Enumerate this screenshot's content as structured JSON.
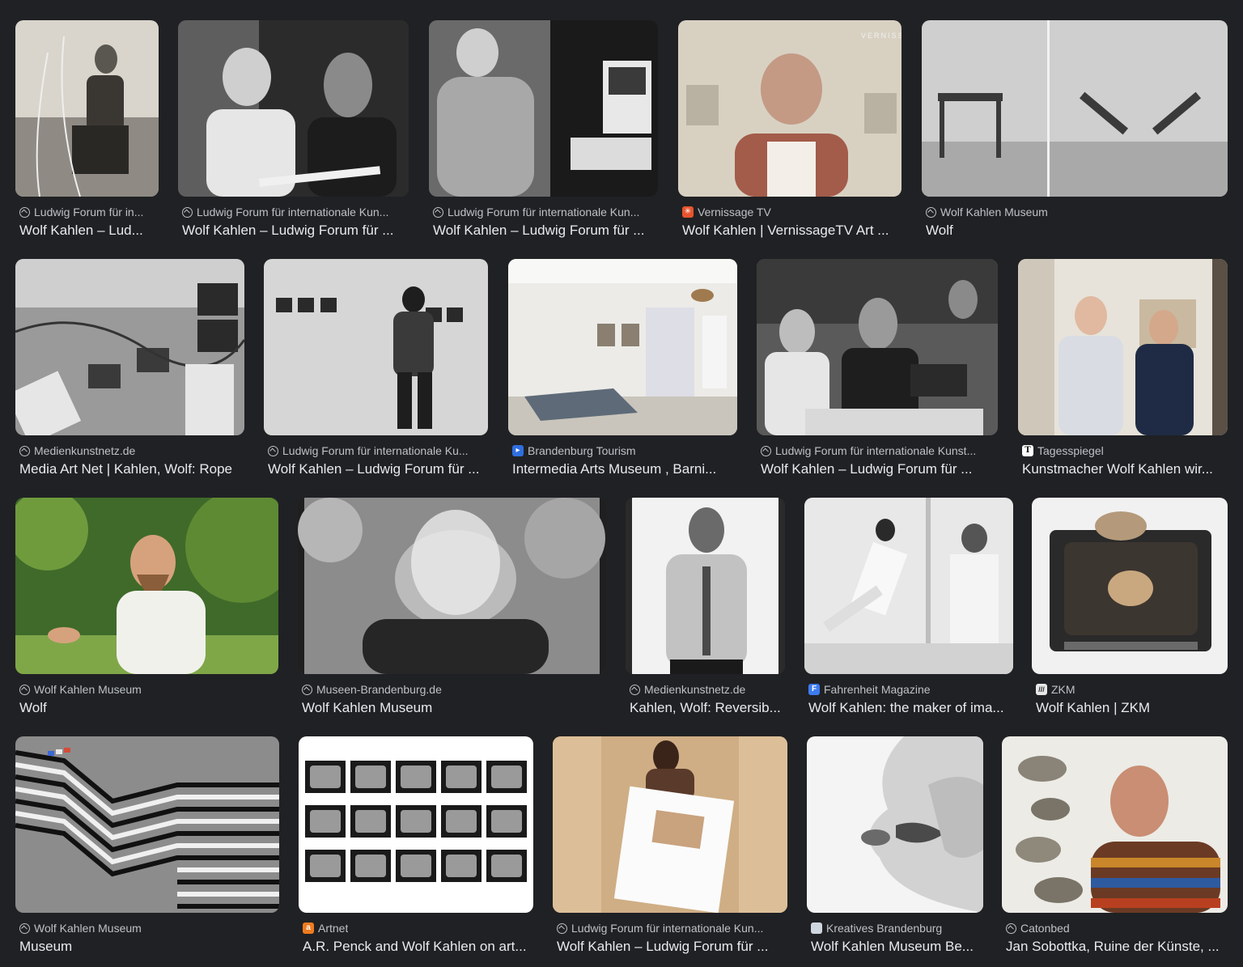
{
  "results": [
    {
      "source": "Ludwig Forum für in...",
      "title": "Wolf Kahlen – Lud...",
      "favicon": "globe-icon"
    },
    {
      "source": "Ludwig Forum für internationale Kun...",
      "title": "Wolf Kahlen – Ludwig Forum für ...",
      "favicon": "globe-icon"
    },
    {
      "source": "Ludwig Forum für internationale Kun...",
      "title": "Wolf Kahlen – Ludwig Forum für ...",
      "favicon": "globe-icon"
    },
    {
      "source": "Vernissage TV",
      "title": "Wolf Kahlen | VernissageTV Art ...",
      "favicon": "vernissage-tv-icon",
      "watermark": "VERNISS"
    },
    {
      "source": "Wolf Kahlen Museum",
      "title": "Wolf",
      "favicon": "globe-icon"
    },
    {
      "source": "Medienkunstnetz.de",
      "title": "Media Art Net | Kahlen, Wolf: Rope",
      "favicon": "globe-icon"
    },
    {
      "source": "Ludwig Forum für internationale Ku...",
      "title": "Wolf Kahlen – Ludwig Forum für ...",
      "favicon": "globe-icon"
    },
    {
      "source": "Brandenburg Tourism",
      "title": "Intermedia Arts Museum , Barni...",
      "favicon": "brandenburg-tourism-icon"
    },
    {
      "source": "Ludwig Forum für internationale Kunst...",
      "title": "Wolf Kahlen – Ludwig Forum für ...",
      "favicon": "globe-icon"
    },
    {
      "source": "Tagesspiegel",
      "title": "Kunstmacher Wolf Kahlen wir...",
      "favicon": "tagesspiegel-icon"
    },
    {
      "source": "Wolf Kahlen Museum",
      "title": "Wolf",
      "favicon": "globe-icon"
    },
    {
      "source": "Museen-Brandenburg.de",
      "title": "Wolf Kahlen Museum",
      "favicon": "globe-icon"
    },
    {
      "source": "Medienkunstnetz.de",
      "title": "Kahlen, Wolf: Reversib...",
      "favicon": "globe-icon"
    },
    {
      "source": "Fahrenheit Magazine",
      "title": "Wolf Kahlen: the maker of ima...",
      "favicon": "fahrenheit-icon"
    },
    {
      "source": "ZKM",
      "title": "Wolf Kahlen | ZKM",
      "favicon": "zkm-icon"
    },
    {
      "source": "Wolf Kahlen Museum",
      "title": "Museum",
      "favicon": "globe-icon"
    },
    {
      "source": "Artnet",
      "title": "A.R. Penck and Wolf Kahlen on art...",
      "favicon": "artnet-icon"
    },
    {
      "source": "Ludwig Forum für internationale Kun...",
      "title": "Wolf Kahlen – Ludwig Forum für ...",
      "favicon": "globe-icon"
    },
    {
      "source": "Kreatives Brandenburg",
      "title": "Wolf Kahlen Museum Be...",
      "favicon": "kreatives-brandenburg-icon"
    },
    {
      "source": "Catonbed",
      "title": "Jan Sobottka, Ruine der Künste, ...",
      "favicon": "globe-icon"
    }
  ],
  "colors": {
    "background": "#202124",
    "source_text": "#bdc1c6",
    "title_text": "#e8eaed"
  }
}
